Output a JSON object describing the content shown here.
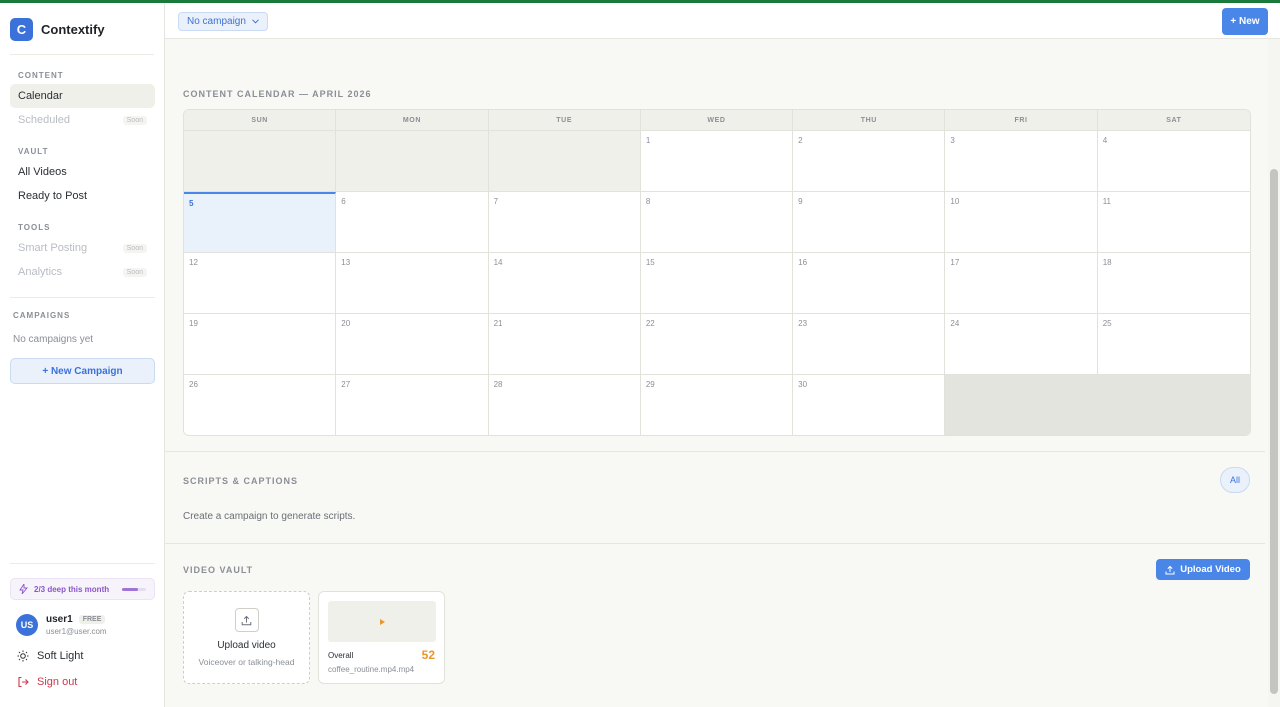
{
  "brand": {
    "logo_letter": "C",
    "name": "Contextify"
  },
  "sidebar": {
    "sections": {
      "content": "CONTENT",
      "vault": "VAULT",
      "tools": "TOOLS",
      "campaigns": "CAMPAIGNS"
    },
    "items": {
      "calendar": "Calendar",
      "scheduled": "Scheduled",
      "all_videos": "All Videos",
      "ready_to_post": "Ready to Post",
      "smart_posting": "Smart Posting",
      "analytics": "Analytics"
    },
    "soon_label": "Soon",
    "no_campaigns": "No campaigns yet",
    "new_campaign": "+ New Campaign",
    "usage": {
      "text": "2/3 deep this month",
      "fraction": 0.67
    },
    "user": {
      "initials": "US",
      "name": "user1",
      "plan": "FREE",
      "email": "user1@user.com"
    },
    "theme_label": "Soft Light",
    "sign_out": "Sign out"
  },
  "header": {
    "campaign_select": "No campaign",
    "new_button": "+ New"
  },
  "calendar": {
    "title": "CONTENT CALENDAR — APRIL 2026",
    "weekdays": [
      "SUN",
      "MON",
      "TUE",
      "WED",
      "THU",
      "FRI",
      "SAT"
    ],
    "cells": [
      "",
      "",
      "",
      "1",
      "2",
      "3",
      "4",
      "5",
      "6",
      "7",
      "8",
      "9",
      "10",
      "11",
      "12",
      "13",
      "14",
      "15",
      "16",
      "17",
      "18",
      "19",
      "20",
      "21",
      "22",
      "23",
      "24",
      "25",
      "26",
      "27",
      "28",
      "29",
      "30",
      "",
      ""
    ],
    "today": "5"
  },
  "scripts": {
    "title": "SCRIPTS & CAPTIONS",
    "filter": "All",
    "empty": "Create a campaign to generate scripts."
  },
  "vault": {
    "title": "VIDEO VAULT",
    "upload_button": "Upload Video",
    "upload_card": {
      "title": "Upload video",
      "subtitle": "Voiceover or talking-head"
    },
    "videos": [
      {
        "score_label": "Overall",
        "score": "52",
        "file": "coffee_routine.mp4.mp4"
      }
    ]
  },
  "colors": {
    "accent": "#4a86e8",
    "score": "#e8962d",
    "danger": "#d0354b",
    "top_bar": "#1a7a3a"
  }
}
